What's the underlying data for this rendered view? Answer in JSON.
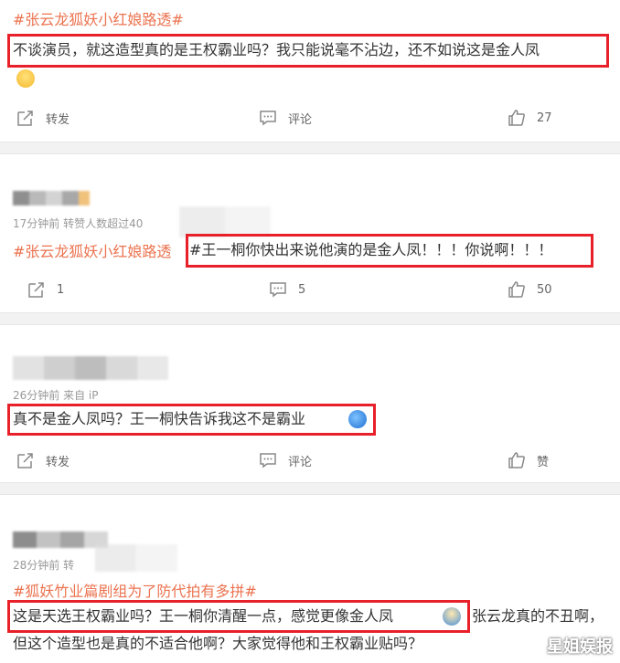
{
  "posts": [
    {
      "topic": "#张云龙狐妖小红娘路透#",
      "text": "不谈演员，就这造型真的是王权霸业吗？我只能说毫不沾边，还不如说这是金人凤",
      "actions": {
        "repost": "转发",
        "comment": "评论",
        "like": "27"
      }
    },
    {
      "meta": "17分钟前  转赞人数超过40",
      "topic": "#张云龙狐妖小红娘路透",
      "text": "#王一桐你快出来说他演的是金人凤！！！你说啊！！！",
      "actions": {
        "repost": "1",
        "comment": "5",
        "like": "50"
      }
    },
    {
      "meta": "26分钟前  来自 iP",
      "text": "真不是金人凤吗？王一桐快告诉我这不是霸业",
      "actions": {
        "repost": "转发",
        "comment": "评论",
        "like": "赞"
      }
    },
    {
      "meta": "28分钟前  转",
      "topic": "#狐妖竹业篇剧组为了防代拍有多拼#",
      "text_line1": "这是天选王权霸业吗？王一桐你清醒一点，感觉更像金人凤",
      "text_line1_tail": "张云龙真的不丑啊，",
      "text_line2": "但这个造型也是真的不适合他啊？大家觉得他和王权霸业贴吗？"
    }
  ],
  "watermark": "星姐娱报",
  "colors": {
    "topic": "#eb7350",
    "highlight_box": "#e8202a",
    "divider": "#f2f2f2"
  }
}
